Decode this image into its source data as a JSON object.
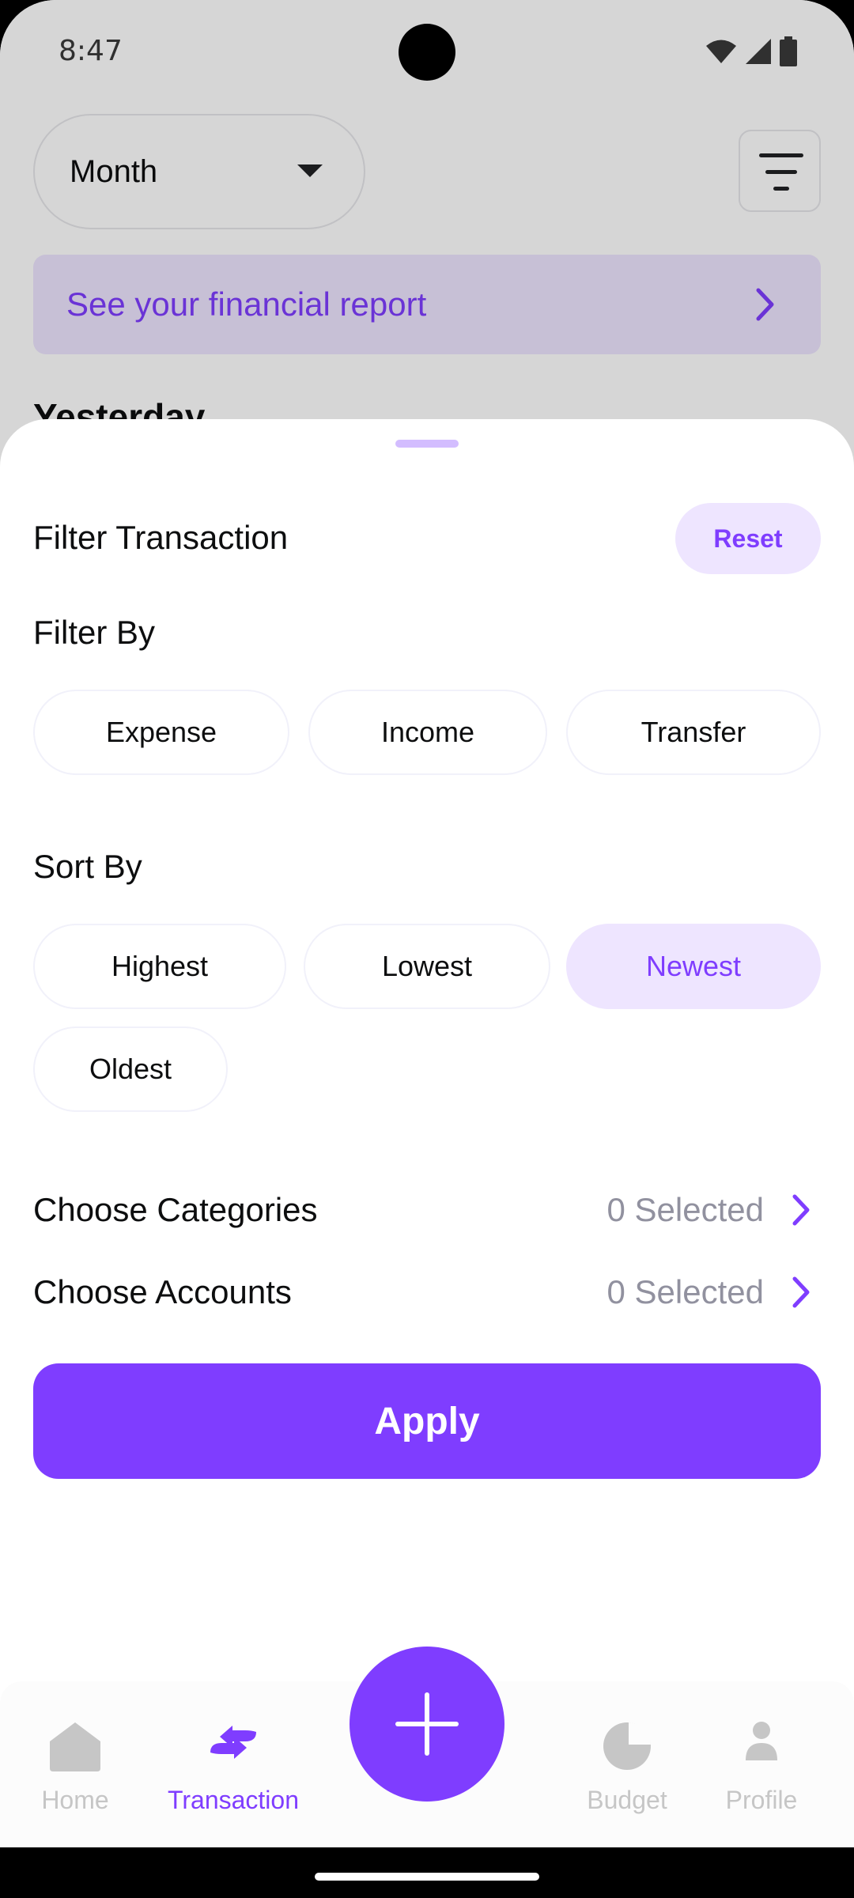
{
  "status_bar": {
    "time": "8:47"
  },
  "background": {
    "period_select": "Month",
    "report_banner": "See your financial report",
    "section_heading": "Yesterday"
  },
  "sheet": {
    "title": "Filter Transaction",
    "reset_label": "Reset",
    "filter_by": {
      "label": "Filter By",
      "options": [
        "Expense",
        "Income",
        "Transfer"
      ]
    },
    "sort_by": {
      "label": "Sort By",
      "options": [
        "Highest",
        "Lowest",
        "Newest",
        "Oldest"
      ],
      "selected": "Newest"
    },
    "categories": {
      "label": "Choose Categories",
      "value": "0 Selected"
    },
    "accounts": {
      "label": "Choose Accounts",
      "value": "0 Selected"
    },
    "apply_label": "Apply"
  },
  "nav": {
    "items": [
      {
        "label": "Home",
        "icon": "home-icon",
        "active": false
      },
      {
        "label": "Transaction",
        "icon": "transaction-icon",
        "active": true
      },
      {
        "label": "Budget",
        "icon": "pie-chart-icon",
        "active": false
      },
      {
        "label": "Profile",
        "icon": "user-icon",
        "active": false
      }
    ],
    "fab_icon": "plus-icon"
  },
  "colors": {
    "accent": "#7F3DFF",
    "accent_light": "#EEE5FF",
    "muted_text": "#91919F",
    "inactive_nav": "#C6C6C6"
  }
}
